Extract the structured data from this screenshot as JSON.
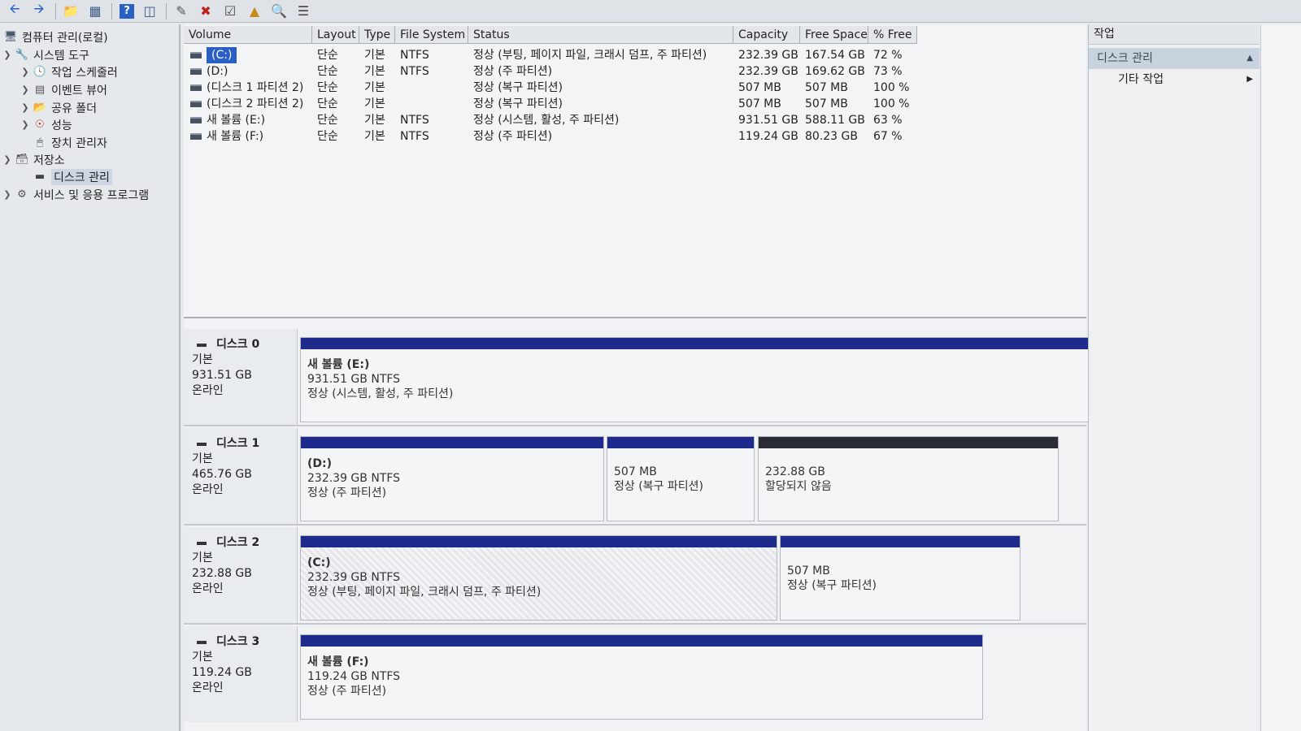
{
  "toolbar": {
    "buttons": [
      "back-arrow-icon",
      "forward-arrow-icon",
      "up-folder-icon",
      "console-tree-icon",
      "help-icon",
      "properties-icon",
      "connect-icon",
      "delete-icon",
      "checkmark-icon",
      "export-icon",
      "search-icon",
      "list-view-icon"
    ]
  },
  "tree": {
    "root": "컴퓨터 관리(로컬)",
    "system_tools": "시스템 도구",
    "task_scheduler": "작업 스케줄러",
    "event_viewer": "이벤트 뷰어",
    "shared_folders": "공유 폴더",
    "performance": "성능",
    "device_manager": "장치 관리자",
    "storage": "저장소",
    "disk_management": "디스크 관리",
    "services_apps": "서비스 및 응용 프로그램"
  },
  "table": {
    "headers": [
      "Volume",
      "Layout",
      "Type",
      "File System",
      "Status",
      "Capacity",
      "Free Space",
      "% Free"
    ],
    "rows": [
      {
        "volume": "(C:)",
        "layout": "단순",
        "type": "기본",
        "fs": "NTFS",
        "status": "정상 (부팅, 페이지 파일, 크래시 덤프, 주 파티션)",
        "capacity": "232.39 GB",
        "free": "167.54 GB",
        "pct": "72 %"
      },
      {
        "volume": "(D:)",
        "layout": "단순",
        "type": "기본",
        "fs": "NTFS",
        "status": "정상 (주 파티션)",
        "capacity": "232.39 GB",
        "free": "169.62 GB",
        "pct": "73 %"
      },
      {
        "volume": "(디스크 1 파티션 2)",
        "layout": "단순",
        "type": "기본",
        "fs": "",
        "status": "정상 (복구 파티션)",
        "capacity": "507 MB",
        "free": "507 MB",
        "pct": "100 %"
      },
      {
        "volume": "(디스크 2 파티션 2)",
        "layout": "단순",
        "type": "기본",
        "fs": "",
        "status": "정상 (복구 파티션)",
        "capacity": "507 MB",
        "free": "507 MB",
        "pct": "100 %"
      },
      {
        "volume": "새 볼륨 (E:)",
        "layout": "단순",
        "type": "기본",
        "fs": "NTFS",
        "status": "정상 (시스템, 활성, 주 파티션)",
        "capacity": "931.51 GB",
        "free": "588.11 GB",
        "pct": "63 %"
      },
      {
        "volume": "새 볼륨 (F:)",
        "layout": "단순",
        "type": "기본",
        "fs": "NTFS",
        "status": "정상 (주 파티션)",
        "capacity": "119.24 GB",
        "free": "80.23 GB",
        "pct": "67 %"
      }
    ]
  },
  "disks": [
    {
      "name": "디스크 0",
      "type": "기본",
      "size": "931.51 GB",
      "state": "온라인",
      "partitions": [
        {
          "name": "새 볼륨 (E:)",
          "line2": "931.51 GB NTFS",
          "line3": "정상 (시스템, 활성, 주 파티션)"
        }
      ]
    },
    {
      "name": "디스크 1",
      "type": "기본",
      "size": "465.76 GB",
      "state": "온라인",
      "partitions": [
        {
          "name": "(D:)",
          "line2": "232.39 GB NTFS",
          "line3": "정상 (주 파티션)"
        },
        {
          "name": "",
          "line2": "507 MB",
          "line3": "정상 (복구 파티션)"
        },
        {
          "name": "",
          "line2": "232.88 GB",
          "line3": "할당되지 않음"
        }
      ]
    },
    {
      "name": "디스크 2",
      "type": "기본",
      "size": "232.88 GB",
      "state": "온라인",
      "partitions": [
        {
          "name": "(C:)",
          "line2": "232.39 GB NTFS",
          "line3": "정상 (부팅, 페이지 파일, 크래시 덤프, 주 파티션)"
        },
        {
          "name": "",
          "line2": "507 MB",
          "line3": "정상 (복구 파티션)"
        }
      ]
    },
    {
      "name": "디스크 3",
      "type": "기본",
      "size": "119.24 GB",
      "state": "온라인",
      "partitions": [
        {
          "name": "새 볼륨 (F:)",
          "line2": "119.24 GB NTFS",
          "line3": "정상 (주 파티션)"
        }
      ]
    }
  ],
  "actions": {
    "header": "작업",
    "section": "디스크 관리",
    "more": "기타 작업"
  },
  "colors": {
    "partition_bar": "#1e2b8c",
    "unallocated_bar": "#2a2c33",
    "selection": "#2a5fc4"
  }
}
